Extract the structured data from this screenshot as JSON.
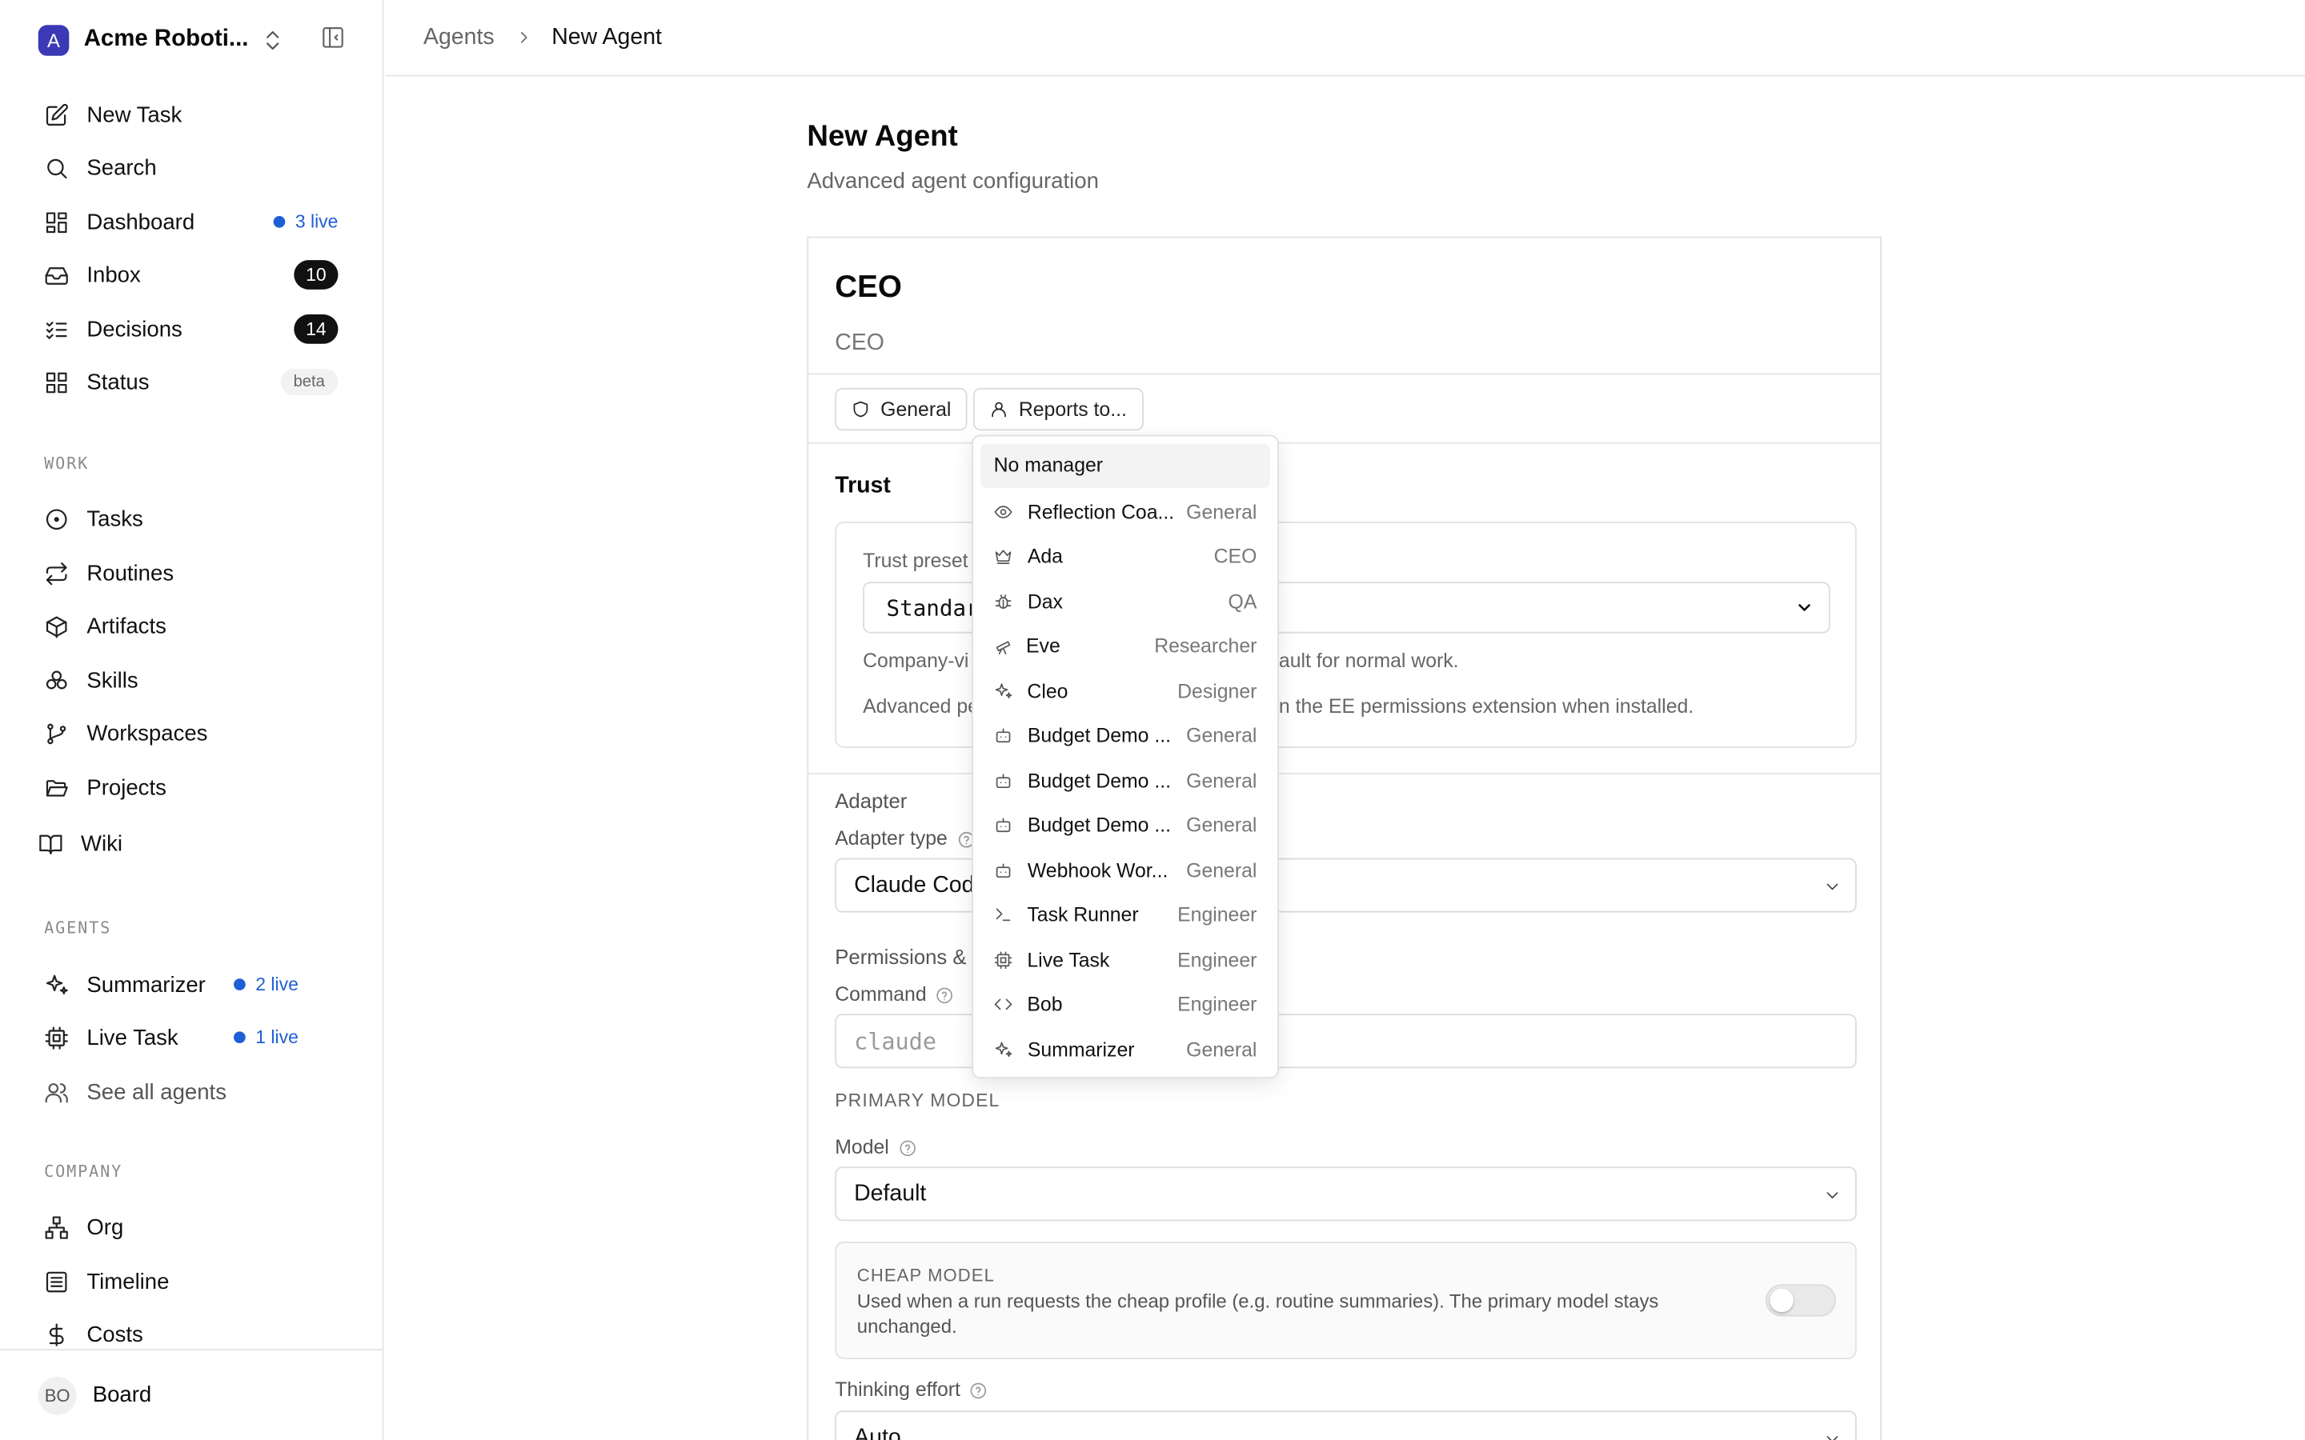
{
  "company": {
    "avatar_letter": "A",
    "name": "Acme Roboti..."
  },
  "nav": {
    "new_task": "New Task",
    "search": "Search",
    "dashboard": "Dashboard",
    "dashboard_live": "3 live",
    "inbox": "Inbox",
    "inbox_count": "10",
    "decisions": "Decisions",
    "decisions_count": "14",
    "status": "Status",
    "status_badge": "beta"
  },
  "work": {
    "heading": "WORK",
    "tasks": "Tasks",
    "routines": "Routines",
    "artifacts": "Artifacts",
    "skills": "Skills",
    "workspaces": "Workspaces",
    "projects": "Projects",
    "wiki": "Wiki"
  },
  "agents": {
    "heading": "AGENTS",
    "summarizer": "Summarizer",
    "summarizer_live": "2 live",
    "live_task": "Live Task",
    "live_task_live": "1 live",
    "see_all": "See all agents"
  },
  "company_section": {
    "heading": "COMPANY",
    "org": "Org",
    "timeline": "Timeline",
    "costs": "Costs"
  },
  "user": {
    "initials": "BO",
    "name": "Board"
  },
  "breadcrumb": {
    "parent": "Agents",
    "current": "New Agent"
  },
  "page": {
    "title": "New Agent",
    "subtitle": "Advanced agent configuration"
  },
  "agent": {
    "name": "CEO",
    "role": "CEO",
    "chip_general": "General",
    "chip_reports_to": "Reports to..."
  },
  "trust": {
    "title": "Trust",
    "preset_label": "Trust preset",
    "preset_value": "Standard",
    "note_1_left": "Company-vi",
    "note_1_right": "ault for normal work.",
    "note_2_left": "Advanced pe",
    "note_2_right": "n the EE permissions extension when installed."
  },
  "adapter": {
    "section": "Adapter",
    "type_label": "Adapter type",
    "type_value": "Claude Code",
    "permissions_label": "Permissions &",
    "command_label": "Command",
    "command_placeholder": "claude",
    "primary_model_heading": "PRIMARY MODEL",
    "model_label": "Model",
    "model_value": "Default",
    "cheap_title": "CHEAP MODEL",
    "cheap_desc": "Used when a run requests the cheap profile (e.g. routine summaries). The primary model stays unchanged.",
    "cheap_enabled": false,
    "thinking_label": "Thinking effort",
    "thinking_value": "Auto"
  },
  "reports_dropdown": {
    "no_manager": "No manager",
    "items": [
      {
        "name": "Reflection Coa...",
        "role": "General",
        "icon": "eye-icon"
      },
      {
        "name": "Ada",
        "role": "CEO",
        "icon": "crown-icon"
      },
      {
        "name": "Dax",
        "role": "QA",
        "icon": "bug-icon"
      },
      {
        "name": "Eve",
        "role": "Researcher",
        "icon": "telescope-icon"
      },
      {
        "name": "Cleo",
        "role": "Designer",
        "icon": "sparkles-icon"
      },
      {
        "name": "Budget Demo ...",
        "role": "General",
        "icon": "bot-icon"
      },
      {
        "name": "Budget Demo ...",
        "role": "General",
        "icon": "bot-icon"
      },
      {
        "name": "Budget Demo ...",
        "role": "General",
        "icon": "bot-icon"
      },
      {
        "name": "Webhook Wor...",
        "role": "General",
        "icon": "bot-icon"
      },
      {
        "name": "Task Runner",
        "role": "Engineer",
        "icon": "terminal-icon"
      },
      {
        "name": "Live Task",
        "role": "Engineer",
        "icon": "cpu-icon"
      },
      {
        "name": "Bob",
        "role": "Engineer",
        "icon": "code-icon"
      },
      {
        "name": "Summarizer",
        "role": "General",
        "icon": "sparkles-icon"
      }
    ]
  },
  "colors": {
    "accent": "#1f5fd6",
    "avatar": "#3b39b5",
    "badge": "#111111"
  }
}
